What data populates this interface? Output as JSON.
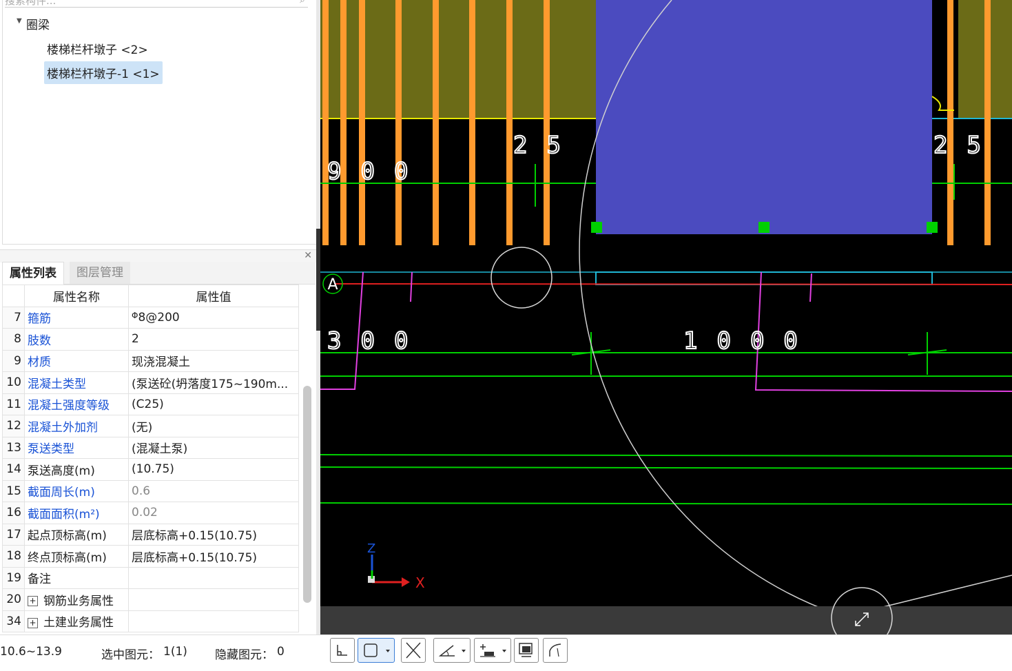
{
  "tree": {
    "search_placeholder": "搜索构件...",
    "group_label": "圈梁",
    "items": [
      {
        "label": "楼梯栏杆墩子 <2>",
        "selected": false
      },
      {
        "label": "楼梯栏杆墩子-1 <1>",
        "selected": true
      }
    ]
  },
  "tabs": [
    {
      "label": "属性列表",
      "active": true
    },
    {
      "label": "图层管理",
      "active": false
    }
  ],
  "props": {
    "header_name": "属性名称",
    "header_value": "属性值",
    "rows": [
      {
        "num": "7",
        "name": "箍筋",
        "value": "8@200",
        "rebar_symbol": "Φ",
        "blue": true
      },
      {
        "num": "8",
        "name": "肢数",
        "value": "2",
        "blue": true
      },
      {
        "num": "9",
        "name": "材质",
        "value": "现浇混凝土",
        "blue": true
      },
      {
        "num": "10",
        "name": "混凝土类型",
        "value": "(泵送砼(坍落度175~190m...",
        "blue": true
      },
      {
        "num": "11",
        "name": "混凝土强度等级",
        "value": "(C25)",
        "blue": true
      },
      {
        "num": "12",
        "name": "混凝土外加剂",
        "value": "(无)",
        "blue": true
      },
      {
        "num": "13",
        "name": "泵送类型",
        "value": "(混凝土泵)",
        "blue": true
      },
      {
        "num": "14",
        "name": "泵送高度(m)",
        "value": "(10.75)",
        "blue": false
      },
      {
        "num": "15",
        "name": "截面周长(m)",
        "value": "0.6",
        "blue": true,
        "gray_value": true
      },
      {
        "num": "16",
        "name": "截面面积(m²)",
        "value": "0.02",
        "blue": true,
        "gray_value": true
      },
      {
        "num": "17",
        "name": "起点顶标高(m)",
        "value": "层底标高+0.15(10.75)",
        "blue": false
      },
      {
        "num": "18",
        "name": "终点顶标高(m)",
        "value": "层底标高+0.15(10.75)",
        "blue": false
      },
      {
        "num": "19",
        "name": "备注",
        "value": "",
        "blue": false
      },
      {
        "num": "20",
        "name": "钢筋业务属性",
        "value": "",
        "blue": false,
        "expand": true
      },
      {
        "num": "34",
        "name": "土建业务属性",
        "value": "",
        "blue": false,
        "expand": true
      }
    ]
  },
  "canvas": {
    "axis_label": "A",
    "dim_900": "900",
    "dim_300": "300",
    "dim_1000": "1000",
    "dim_25_left": "25",
    "dim_25_right": "25",
    "axis_x": "X",
    "axis_z": "Z"
  },
  "status": {
    "range": "10.6~13.9",
    "selected_label": "选中图元：",
    "selected_value": "1(1)",
    "hidden_label": "隐藏图元：",
    "hidden_value": "0"
  },
  "colors": {
    "olive": "#6b6b17",
    "purple_block": "#4b4bbf",
    "orange": "#ff9a2e",
    "green": "#00d000",
    "cyan": "#1fb7d4",
    "magenta": "#e040e0",
    "red": "#e02020"
  }
}
